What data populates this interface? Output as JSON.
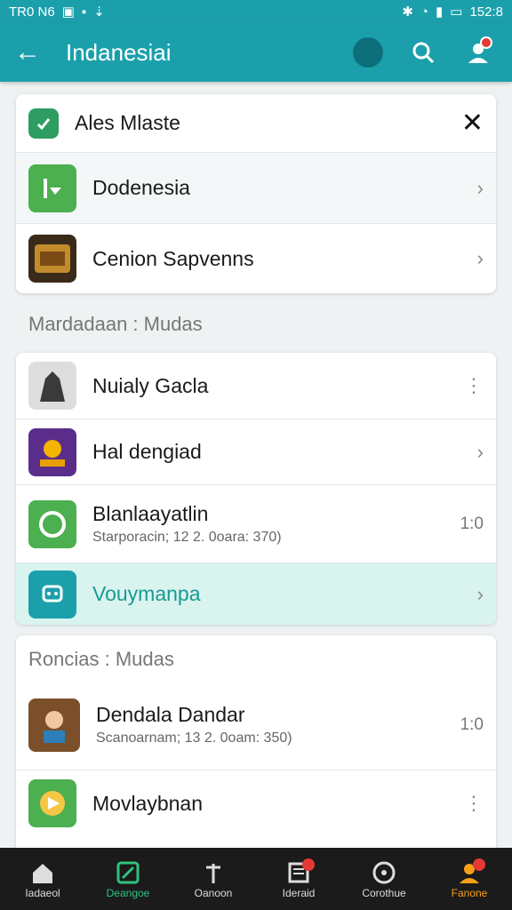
{
  "status": {
    "left": "TR0 N6",
    "time": "152:8"
  },
  "appbar": {
    "title": "Indanesiai"
  },
  "top_card": {
    "header": "Ales Mlaste",
    "items": [
      {
        "label": "Dodenesia"
      },
      {
        "label": "Cenion Sapvenns"
      }
    ]
  },
  "section1": {
    "title": "Mardadaan : Mudas"
  },
  "list1": [
    {
      "label": "Nuialy Gacla"
    },
    {
      "label": "Hal dengiad"
    },
    {
      "label": "Blanlaayatlin",
      "sub": "Starporacin; 12 2. 0oara: 370)",
      "meta": "1:0"
    },
    {
      "label": "Vouymanpa"
    }
  ],
  "section2": {
    "title": "Roncias : Mudas"
  },
  "list2": [
    {
      "label": "Dendala Dandar",
      "sub": "Scanoarnam; 13 2. 0oam: 350)",
      "meta": "1:0"
    },
    {
      "label": "Movlaybnan"
    }
  ],
  "tabs": [
    {
      "label": "Iadaeol"
    },
    {
      "label": "Deangoe"
    },
    {
      "label": "Oanoon"
    },
    {
      "label": "Ideraid"
    },
    {
      "label": "Corothue"
    },
    {
      "label": "Fanone"
    }
  ],
  "colors": {
    "primary": "#1ba0ab",
    "green": "#4caf50",
    "highlight": "#d9f3ef"
  }
}
